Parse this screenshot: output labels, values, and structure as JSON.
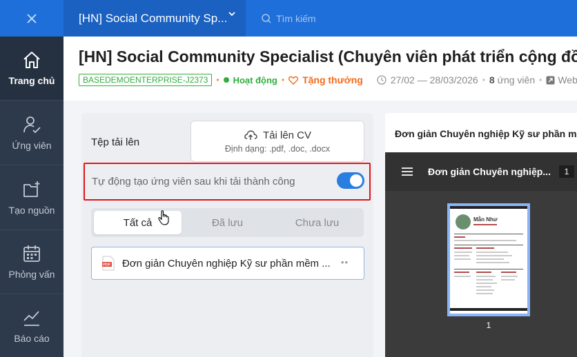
{
  "sidebar": {
    "items": [
      {
        "label": "Trang chủ",
        "icon": "home-icon"
      },
      {
        "label": "Ứng viên",
        "icon": "user-check-icon"
      },
      {
        "label": "Tạo nguồn",
        "icon": "folder-add-icon"
      },
      {
        "label": "Phỏng vấn",
        "icon": "calendar-icon"
      },
      {
        "label": "Báo cáo",
        "icon": "chart-line-icon"
      }
    ]
  },
  "topbar": {
    "job_select": "[HN] Social Community Sp...",
    "search_placeholder": "Tìm kiếm"
  },
  "header": {
    "title": "[HN] Social Community Specialist (Chuyên viên phát triển cộng đồng)",
    "job_code": "BASEDEMOENTERPRISE-J2373",
    "status": "Hoạt động",
    "reward": "Tặng thưởng",
    "date_range": "27/02 — 28/03/2026",
    "candidate_count": "8",
    "candidate_label": "ứng viên",
    "website": "Webs"
  },
  "upload": {
    "file_label": "Tệp tải lên",
    "button_label": "Tải lên CV",
    "formats": "Định dạng: .pdf, .doc, .docx",
    "auto_create_label": "Tự động tạo ứng viên sau khi tải thành công",
    "auto_create_enabled": true,
    "tabs": [
      "Tất cả",
      "Đã lưu",
      "Chưa lưu"
    ],
    "active_tab": "Tất cả",
    "file_item": {
      "name": "Đơn giản Chuyên nghiệp Kỹ sư phần mềm ...",
      "type_badge": "PDF"
    }
  },
  "preview": {
    "title": "Đơn giản Chuyên nghiệp Kỹ sư phần mề",
    "viewer_doc_name": "Đơn giản Chuyên nghiệp...",
    "viewer_page": "1",
    "thumb_name": "Mẫn Như",
    "thumb_page": "1"
  },
  "colors": {
    "brand_blue": "#1e6fd9",
    "sidebar_bg": "#2d3a4b",
    "success_green": "#2fae3c",
    "reward_orange": "#f26a1b",
    "highlight_red": "#e0141a"
  }
}
